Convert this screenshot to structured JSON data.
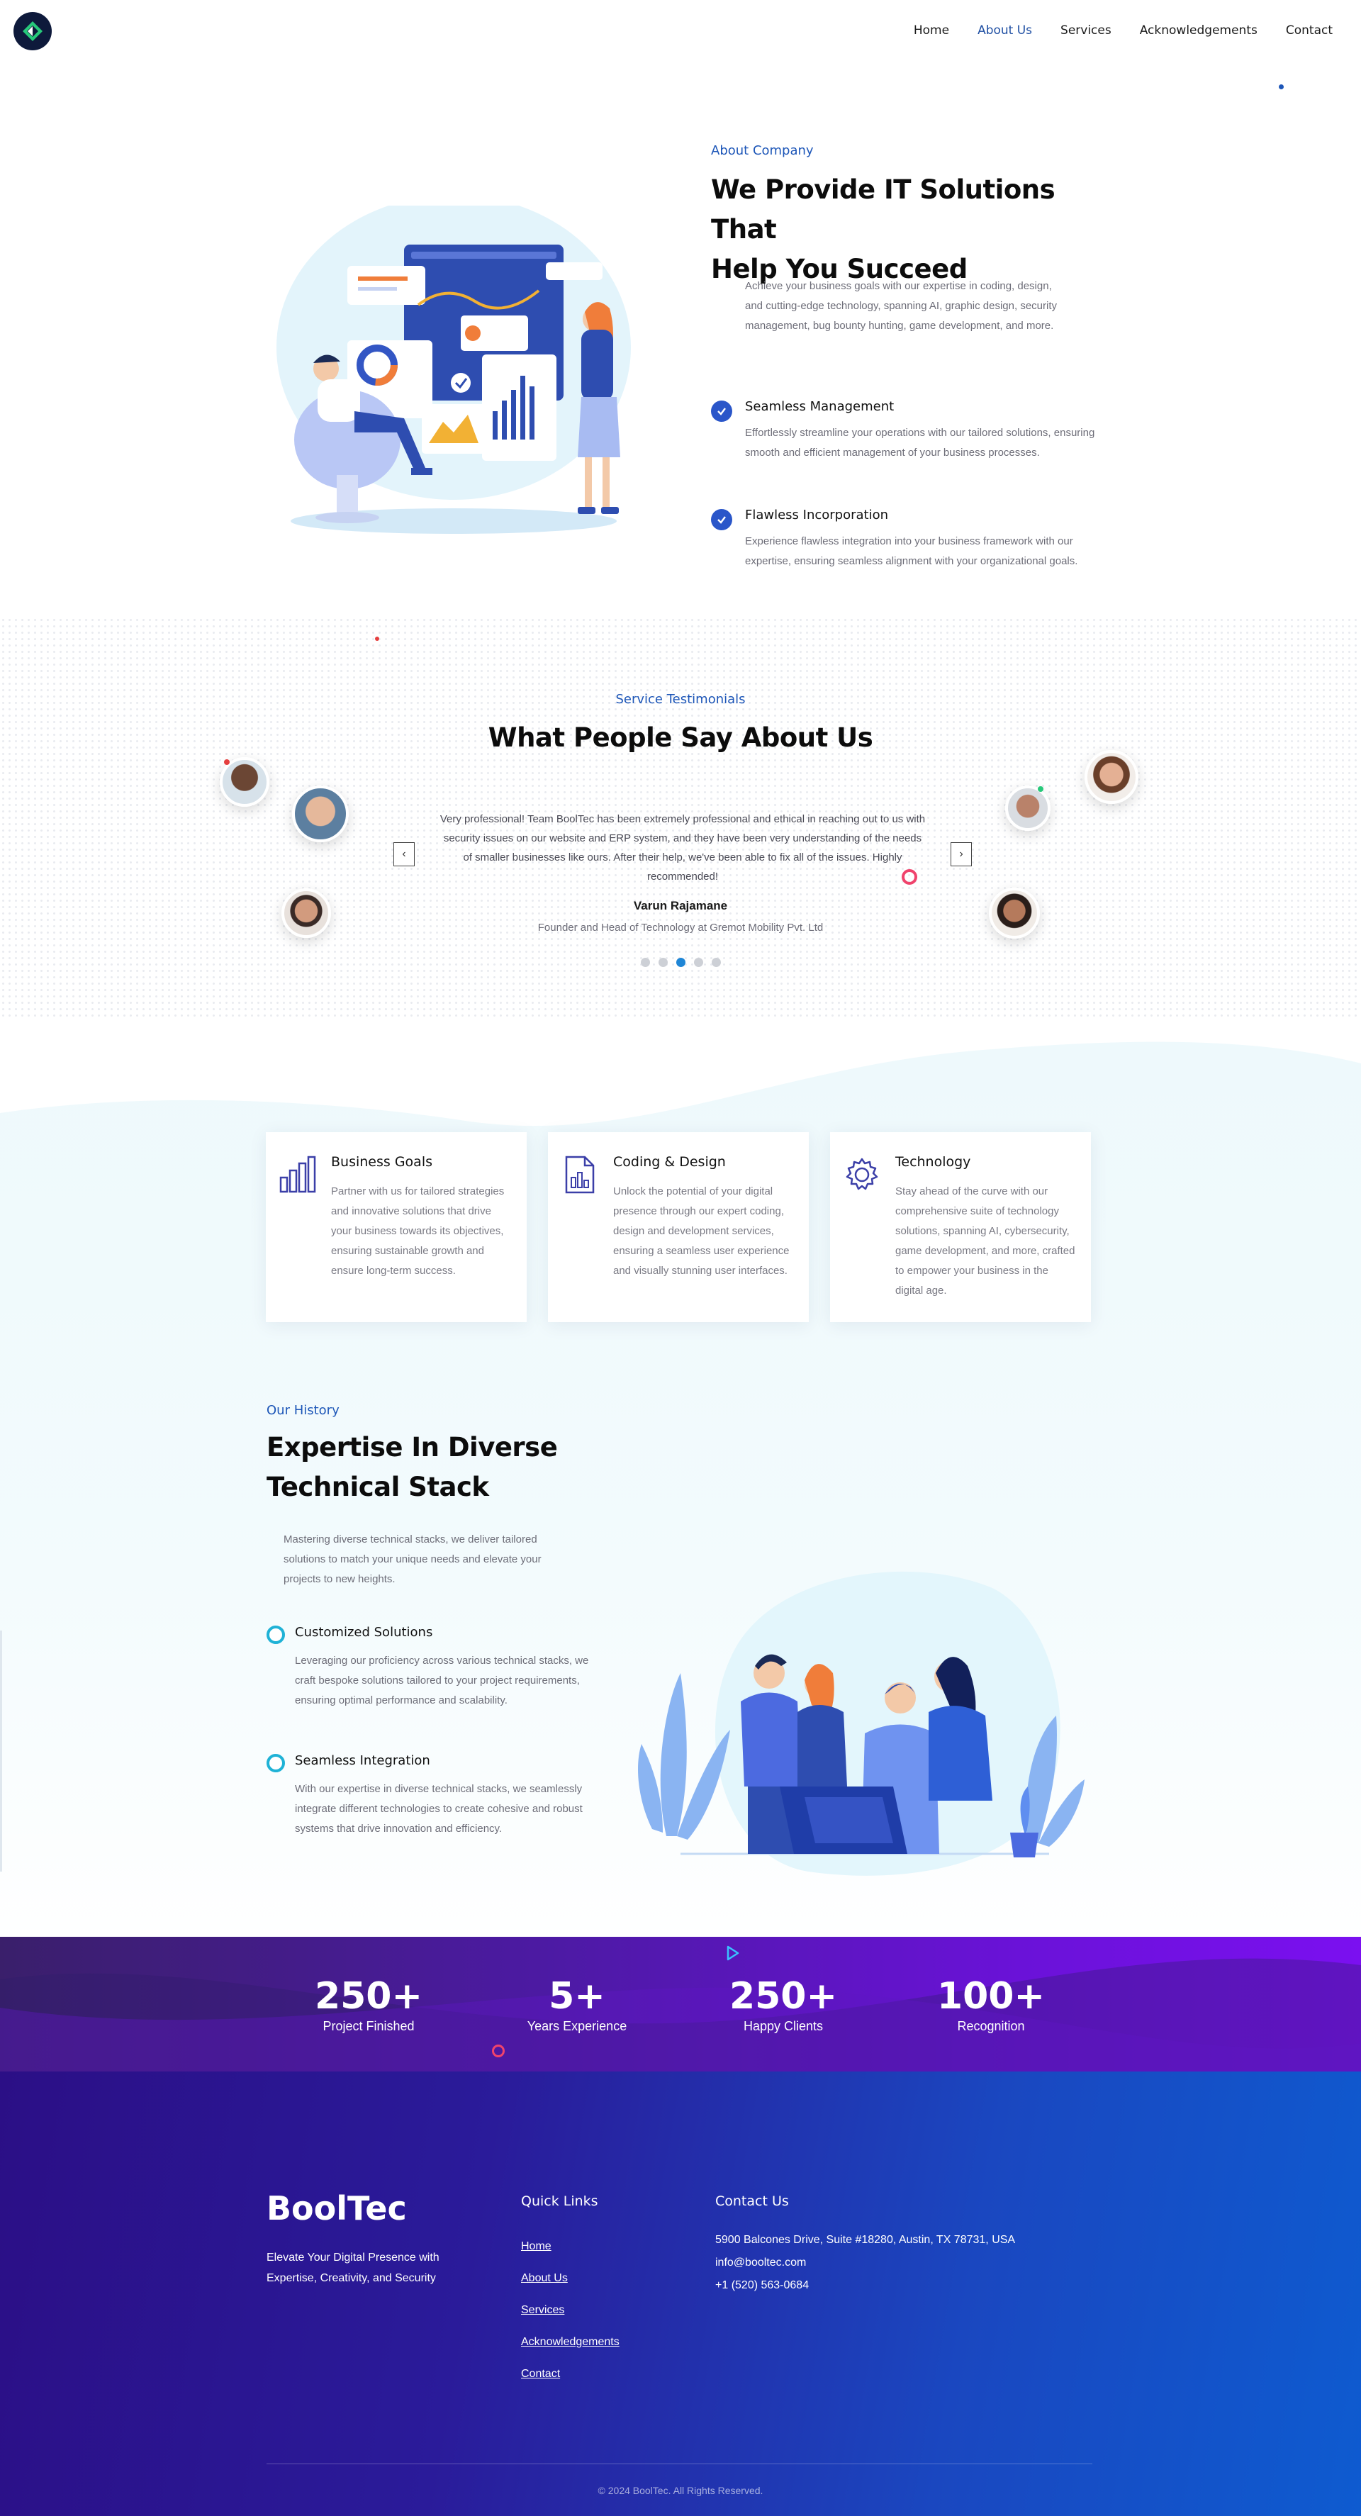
{
  "header": {
    "logo_alt": "BoolTec logo",
    "nav": [
      {
        "label": "Home",
        "active": false
      },
      {
        "label": "About Us",
        "active": true
      },
      {
        "label": "Services",
        "active": false
      },
      {
        "label": "Acknowledgements",
        "active": false
      },
      {
        "label": "Contact",
        "active": false
      }
    ]
  },
  "about": {
    "eyebrow": "About Company",
    "title_line1": "We Provide IT Solutions That",
    "title_line2": "Help You Succeed",
    "intro": "Achieve your business goals with our expertise in coding, design, and cutting-edge technology, spanning AI, graphic design, security management, bug bounty hunting, game development, and more.",
    "features": [
      {
        "title": "Seamless Management",
        "text": "Effortlessly streamline your operations with our tailored solutions, ensuring smooth and efficient management of your business processes."
      },
      {
        "title": "Flawless Incorporation",
        "text": "Experience flawless integration into your business framework with our expertise, ensuring seamless alignment with your organizational goals."
      }
    ]
  },
  "testimonials": {
    "eyebrow": "Service Testimonials",
    "title": "What People Say About Us",
    "quote": "Very professional! Team BoolTec has been extremely professional and ethical in reaching out to us with security issues on our website and ERP system, and they have been very understanding of the needs of smaller businesses like ours. After their help, we've been able to fix all of the issues. Highly recommended!",
    "author": "Varun Rajamane",
    "role": "Founder and Head of Technology at Gremot Mobility Pvt. Ltd",
    "prev_icon": "chevron-left-icon",
    "next_icon": "chevron-right-icon",
    "active_slide": 3,
    "slide_count": 5
  },
  "services": [
    {
      "title": "Business Goals",
      "icon": "bar-chart-icon",
      "text": "Partner with us for tailored strategies and innovative solutions that drive your business towards its objectives, ensuring sustainable growth and ensure long-term success."
    },
    {
      "title": "Coding & Design",
      "icon": "document-chart-icon",
      "text": "Unlock the potential of your digital presence through our expert coding, design and development services, ensuring a seamless user experience and visually stunning user interfaces."
    },
    {
      "title": "Technology",
      "icon": "gear-icon",
      "text": "Stay ahead of the curve with our comprehensive suite of technology solutions, spanning AI, cybersecurity, game development, and more, crafted to empower your business in the digital age."
    }
  ],
  "history": {
    "eyebrow": "Our History",
    "title_line1": "Expertise In Diverse",
    "title_line2": "Technical Stack",
    "intro": "Mastering diverse technical stacks, we deliver tailored solutions to match your unique needs and elevate your projects to new heights.",
    "features": [
      {
        "title": "Customized Solutions",
        "text": "Leveraging our proficiency across various technical stacks, we craft bespoke solutions tailored to your project requirements, ensuring optimal performance and scalability."
      },
      {
        "title": "Seamless Integration",
        "text": "With our expertise in diverse technical stacks, we seamlessly integrate different technologies to create cohesive and robust systems that drive innovation and efficiency."
      }
    ]
  },
  "counters": [
    {
      "value": "250+",
      "label": "Project Finished"
    },
    {
      "value": "5+",
      "label": "Years Experience"
    },
    {
      "value": "250+",
      "label": "Happy Clients"
    },
    {
      "value": "100+",
      "label": "Recognition"
    }
  ],
  "footer": {
    "brand": "BoolTec",
    "tagline": "Elevate Your Digital Presence with Expertise, Creativity, and Security",
    "quick_links_title": "Quick Links",
    "quick_links": [
      "Home",
      "About Us",
      "Services",
      "Acknowledgements",
      "Contact"
    ],
    "contact_title": "Contact Us",
    "address": "5900 Balcones Drive, Suite #18280, Austin, TX 78731, USA",
    "email": "info@booltec.com",
    "phone": "+1 (520) 563-0684",
    "copyright": "© 2024 BoolTec. All Rights Reserved."
  },
  "colors": {
    "accent": "#1d56b8",
    "check": "#2a56c9",
    "ring": "#1fb2d6",
    "counter_start": "#3a1f6b",
    "counter_end": "#7b10f0",
    "footer_start": "#2b0f86",
    "footer_end": "#0e5bd0"
  }
}
